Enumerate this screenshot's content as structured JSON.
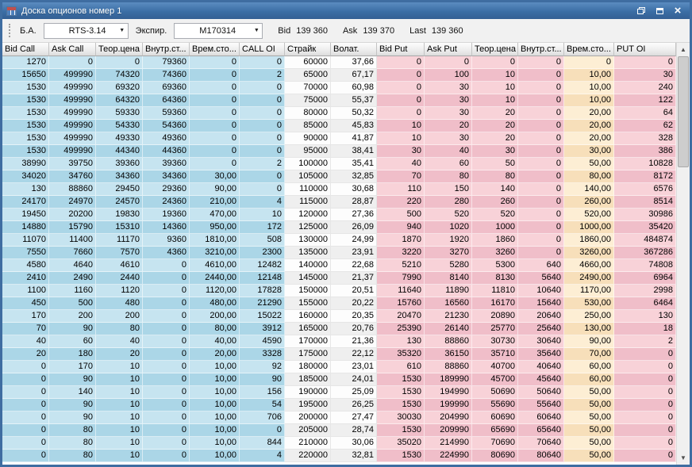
{
  "window": {
    "title": "Доска опционов номер 1"
  },
  "toolbar": {
    "underlying_label": "Б.А.",
    "underlying_value": "RTS-3.14",
    "expiry_label": "Экспир.",
    "expiry_value": "M170314",
    "quotes": [
      {
        "label": "Bid",
        "value": "139 360"
      },
      {
        "label": "Ask",
        "value": "139 370"
      },
      {
        "label": "Last",
        "value": "139 360"
      }
    ]
  },
  "table": {
    "headers": [
      "Bid Call",
      "Ask Call",
      "Теор.цена",
      "Внутр.ст...",
      "Врем.сто...",
      "CALL OI",
      "Страйк",
      "Волат.",
      "Bid Put",
      "Ask Put",
      "Теор.цена",
      "Внутр.ст...",
      "Врем.сто...",
      "PUT OI"
    ],
    "rows": [
      [
        "1270",
        "0",
        "0",
        "79360",
        "0",
        "0",
        "60000",
        "37,66",
        "0",
        "0",
        "0",
        "0",
        "0",
        "0"
      ],
      [
        "15650",
        "499990",
        "74320",
        "74360",
        "0",
        "2",
        "65000",
        "67,17",
        "0",
        "100",
        "10",
        "0",
        "10,00",
        "30"
      ],
      [
        "1530",
        "499990",
        "69320",
        "69360",
        "0",
        "0",
        "70000",
        "60,98",
        "0",
        "30",
        "10",
        "0",
        "10,00",
        "240"
      ],
      [
        "1530",
        "499990",
        "64320",
        "64360",
        "0",
        "0",
        "75000",
        "55,37",
        "0",
        "30",
        "10",
        "0",
        "10,00",
        "122"
      ],
      [
        "1530",
        "499990",
        "59330",
        "59360",
        "0",
        "0",
        "80000",
        "50,32",
        "0",
        "30",
        "20",
        "0",
        "20,00",
        "64"
      ],
      [
        "1530",
        "499990",
        "54330",
        "54360",
        "0",
        "0",
        "85000",
        "45,83",
        "10",
        "20",
        "20",
        "0",
        "20,00",
        "62"
      ],
      [
        "1530",
        "499990",
        "49330",
        "49360",
        "0",
        "0",
        "90000",
        "41,87",
        "10",
        "30",
        "20",
        "0",
        "20,00",
        "328"
      ],
      [
        "1530",
        "499990",
        "44340",
        "44360",
        "0",
        "0",
        "95000",
        "38,41",
        "30",
        "40",
        "30",
        "0",
        "30,00",
        "386"
      ],
      [
        "38990",
        "39750",
        "39360",
        "39360",
        "0",
        "2",
        "100000",
        "35,41",
        "40",
        "60",
        "50",
        "0",
        "50,00",
        "10828"
      ],
      [
        "34020",
        "34760",
        "34360",
        "34360",
        "30,00",
        "0",
        "105000",
        "32,85",
        "70",
        "80",
        "80",
        "0",
        "80,00",
        "8172"
      ],
      [
        "130",
        "88860",
        "29450",
        "29360",
        "90,00",
        "0",
        "110000",
        "30,68",
        "110",
        "150",
        "140",
        "0",
        "140,00",
        "6576"
      ],
      [
        "24170",
        "24970",
        "24570",
        "24360",
        "210,00",
        "4",
        "115000",
        "28,87",
        "220",
        "280",
        "260",
        "0",
        "260,00",
        "8514"
      ],
      [
        "19450",
        "20200",
        "19830",
        "19360",
        "470,00",
        "10",
        "120000",
        "27,36",
        "500",
        "520",
        "520",
        "0",
        "520,00",
        "30986"
      ],
      [
        "14880",
        "15790",
        "15310",
        "14360",
        "950,00",
        "172",
        "125000",
        "26,09",
        "940",
        "1020",
        "1000",
        "0",
        "1000,00",
        "35420"
      ],
      [
        "11070",
        "11400",
        "11170",
        "9360",
        "1810,00",
        "508",
        "130000",
        "24,99",
        "1870",
        "1920",
        "1860",
        "0",
        "1860,00",
        "484874"
      ],
      [
        "7550",
        "7660",
        "7570",
        "4360",
        "3210,00",
        "2300",
        "135000",
        "23,91",
        "3220",
        "3270",
        "3260",
        "0",
        "3260,00",
        "367286"
      ],
      [
        "4580",
        "4640",
        "4610",
        "0",
        "4610,00",
        "12482",
        "140000",
        "22,68",
        "5210",
        "5280",
        "5300",
        "640",
        "4660,00",
        "74808"
      ],
      [
        "2410",
        "2490",
        "2440",
        "0",
        "2440,00",
        "12148",
        "145000",
        "21,37",
        "7990",
        "8140",
        "8130",
        "5640",
        "2490,00",
        "6964"
      ],
      [
        "1100",
        "1160",
        "1120",
        "0",
        "1120,00",
        "17828",
        "150000",
        "20,51",
        "11640",
        "11890",
        "11810",
        "10640",
        "1170,00",
        "2998"
      ],
      [
        "450",
        "500",
        "480",
        "0",
        "480,00",
        "21290",
        "155000",
        "20,22",
        "15760",
        "16560",
        "16170",
        "15640",
        "530,00",
        "6464"
      ],
      [
        "170",
        "200",
        "200",
        "0",
        "200,00",
        "15022",
        "160000",
        "20,35",
        "20470",
        "21230",
        "20890",
        "20640",
        "250,00",
        "130"
      ],
      [
        "70",
        "90",
        "80",
        "0",
        "80,00",
        "3912",
        "165000",
        "20,76",
        "25390",
        "26140",
        "25770",
        "25640",
        "130,00",
        "18"
      ],
      [
        "40",
        "60",
        "40",
        "0",
        "40,00",
        "4590",
        "170000",
        "21,36",
        "130",
        "88860",
        "30730",
        "30640",
        "90,00",
        "2"
      ],
      [
        "20",
        "180",
        "20",
        "0",
        "20,00",
        "3328",
        "175000",
        "22,12",
        "35320",
        "36150",
        "35710",
        "35640",
        "70,00",
        "0"
      ],
      [
        "0",
        "170",
        "10",
        "0",
        "10,00",
        "92",
        "180000",
        "23,01",
        "610",
        "88860",
        "40700",
        "40640",
        "60,00",
        "0"
      ],
      [
        "0",
        "90",
        "10",
        "0",
        "10,00",
        "90",
        "185000",
        "24,01",
        "1530",
        "189990",
        "45700",
        "45640",
        "60,00",
        "0"
      ],
      [
        "0",
        "140",
        "10",
        "0",
        "10,00",
        "156",
        "190000",
        "25,09",
        "1530",
        "194990",
        "50690",
        "50640",
        "50,00",
        "0"
      ],
      [
        "0",
        "90",
        "10",
        "0",
        "10,00",
        "54",
        "195000",
        "26,25",
        "1530",
        "199990",
        "55690",
        "55640",
        "50,00",
        "0"
      ],
      [
        "0",
        "90",
        "10",
        "0",
        "10,00",
        "706",
        "200000",
        "27,47",
        "30030",
        "204990",
        "60690",
        "60640",
        "50,00",
        "0"
      ],
      [
        "0",
        "80",
        "10",
        "0",
        "10,00",
        "0",
        "205000",
        "28,74",
        "1530",
        "209990",
        "65690",
        "65640",
        "50,00",
        "0"
      ],
      [
        "0",
        "80",
        "10",
        "0",
        "10,00",
        "844",
        "210000",
        "30,06",
        "35020",
        "214990",
        "70690",
        "70640",
        "50,00",
        "0"
      ],
      [
        "0",
        "80",
        "10",
        "0",
        "10,00",
        "4",
        "220000",
        "32,81",
        "1530",
        "224990",
        "80690",
        "80640",
        "50,00",
        "0"
      ]
    ],
    "column_kinds": [
      "call",
      "call",
      "call",
      "call",
      "call",
      "call",
      "strike",
      "strike",
      "put",
      "put",
      "put",
      "put",
      "cream",
      "put"
    ]
  },
  "colors": {
    "call_bg": "#abd6e7",
    "call_bg_alt": "#c6e4f0",
    "put_bg": "#f0bec9",
    "put_bg_alt": "#f8d2d8",
    "time_put_bg": "#f7dfba",
    "time_put_bg_alt": "#fdeed4",
    "strike_bg": "#efefef",
    "strike_bg_alt": "#fdfdfd",
    "titlebar": "#3b6ea5"
  }
}
